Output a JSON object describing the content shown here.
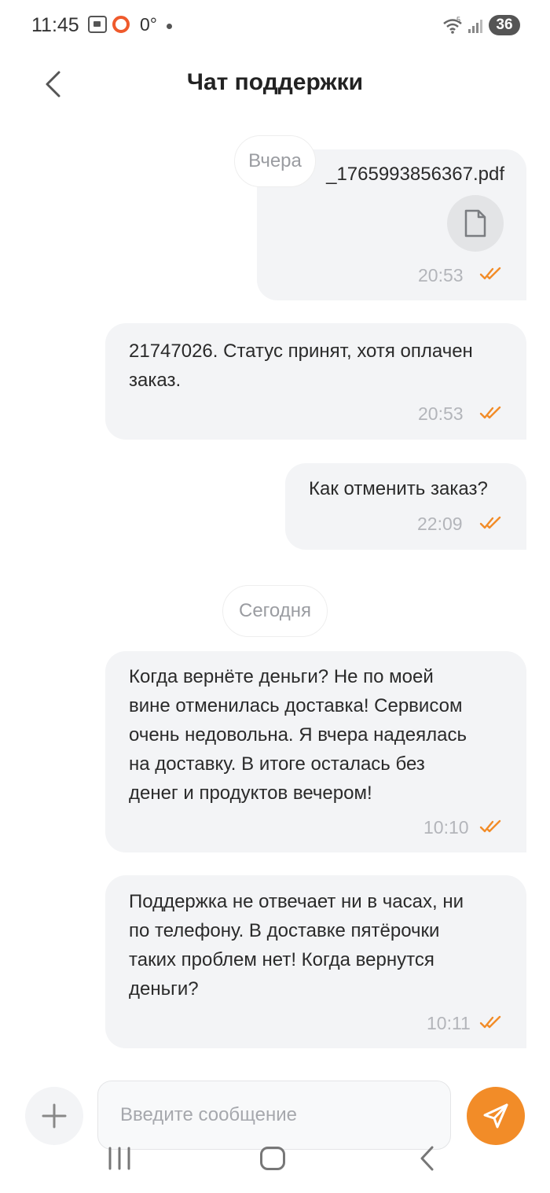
{
  "status_bar": {
    "time": "11:45",
    "temperature": "0°",
    "battery": "36",
    "signal_label": "5"
  },
  "header": {
    "title": "Чат поддержки"
  },
  "messages": [
    {
      "type": "file",
      "file_name": "_1765993856367.pdf",
      "time": "20:53",
      "status": "read"
    },
    {
      "type": "text",
      "text": "21747026. Статус принят, хотя оплачен\nзаказ.",
      "time": "20:53",
      "status": "read"
    },
    {
      "type": "text",
      "text": "Как отменить заказ?",
      "time": "22:09",
      "status": "read"
    },
    {
      "type": "text",
      "text": "Когда вернёте деньги? Не по моей\nвине отменилась доставка! Сервисом\nочень недовольна. Я вчера надеялась\nна доставку. В итоге осталась без\nденег и продуктов вечером!",
      "time": "10:10",
      "status": "read"
    },
    {
      "type": "text",
      "text": "Поддержка не отвечает ни в часах, ни\nпо телефону. В доставке пятёрочки\nтаких проблем нет! Когда вернутся\nденьги?",
      "time": "10:11",
      "status": "read"
    }
  ],
  "date_dividers": [
    "Вчера",
    "Сегодня"
  ],
  "composer": {
    "placeholder": "Введите сообщение",
    "value": ""
  },
  "colors": {
    "accent": "#f28c28",
    "bubble": "#f3f4f6",
    "check": "#f28c28",
    "time": "#b3b5ba"
  },
  "icons": {
    "back": "chevron-left-icon",
    "file": "document-icon",
    "add": "plus-icon",
    "send": "paper-plane-icon"
  }
}
